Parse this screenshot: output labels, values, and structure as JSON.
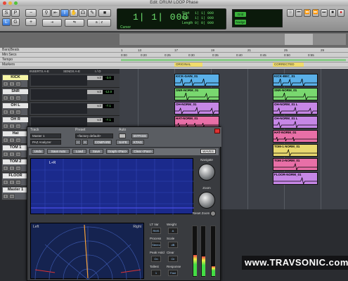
{
  "window": {
    "title": "Edit: DRUM LOOP Phase"
  },
  "counter": {
    "main": "1| 1| 000",
    "start_label": "Start",
    "end_label": "End",
    "length_label": "Length",
    "start": "1| 1| 000",
    "end": "1| 1| 000",
    "length": "0| 0| 000",
    "cursor_label": "Cursor"
  },
  "grid": {
    "grid_label": "Grid",
    "nudge_label": "Nudge"
  },
  "rulers": {
    "bars_beats": "Bars|Beats",
    "min_secs": "Min:Secs",
    "tempo": "Tempo",
    "markers": "Markers",
    "bar_ticks": [
      "1",
      "13",
      "17",
      "19",
      "21",
      "25",
      "29"
    ],
    "time_ticks": [
      "0:00",
      "0:20",
      "0:25",
      "0:30",
      "0:35",
      "0:40",
      "0:45",
      "0:50",
      "0:55"
    ],
    "marker_labels": [
      "ORIGINAL",
      "CORRECTED"
    ]
  },
  "mix_header": {
    "inserts": "INSERTS A-E",
    "sends": "SENDS A-E",
    "io": "I / O"
  },
  "tracks": [
    {
      "name": "KICK",
      "vol": "vol",
      "val": "-3.0"
    },
    {
      "name": "SNR",
      "vol": "vol",
      "val": "-12.0"
    },
    {
      "name": "OH L",
      "vol": "vol",
      "val": "-7.1"
    },
    {
      "name": "OH R",
      "vol": "vol",
      "val": "-7.1"
    },
    {
      "name": "Hat",
      "vol": "vol",
      "val": "-8.4"
    },
    {
      "name": "TOM 1",
      "vol": "",
      "val": ""
    },
    {
      "name": "TOM 2",
      "vol": "",
      "val": ""
    },
    {
      "name": "FLOOR",
      "vol": "",
      "val": ""
    },
    {
      "name": "Master 1",
      "vol": "",
      "val": ""
    }
  ],
  "clips": {
    "original": [
      "KICK-GAIN_01",
      "SNR-NORM_01",
      "OH-NORM_01",
      "HAT-NORM_01"
    ],
    "corrected": [
      "KICK-BEC_01",
      "SNR-NORM_01",
      "OH-NORM_01 L",
      "HAT-NORM_01",
      "TOM-1 NORM_01",
      "TOM 2-NORM_01",
      "FLOOR-NORM_01"
    ]
  },
  "plugin": {
    "track_label": "Track",
    "preset_label": "Preset",
    "auto_label": "Auto",
    "track_value": "Master 1",
    "insert_value": "PAZ Analyzer",
    "preset_value": "<factory default>",
    "bypass": "BYPASS",
    "compare": "COMPARE",
    "safe": "SAFE",
    "ktag": "KTAG",
    "minus": "-",
    "plus": "+",
    "toolbar": [
      "Undo",
      "Save Auto",
      "Load",
      "Save",
      "Graph <Pan>",
      "Clear <Pan>"
    ],
    "brand": "WAVES",
    "spectrum_label": "L+R",
    "scope_left": "Left",
    "scope_right": "Right",
    "knob_navigate": "Navigate",
    "knob_zoom": "Zoom",
    "reset_zoom": "Reset Zoom",
    "ctrl_labels": [
      "LT Var",
      "Weight",
      "Process",
      "Scale",
      "Peak Hold",
      "Clear",
      "Tallest",
      "Response"
    ],
    "ctrl_values": [
      "RMS",
      "A",
      "Stereo",
      "dB",
      "On",
      "Clr",
      "1",
      "Fast"
    ]
  },
  "watermark": "www.TRAVSONIC.com",
  "colors": {
    "original_clip": "#5ab0e8",
    "snr_clip": "#79d86f",
    "oh_clip": "#c687e6",
    "hat_clip": "#e86fa7",
    "tom_clip": "#e8d86f"
  }
}
